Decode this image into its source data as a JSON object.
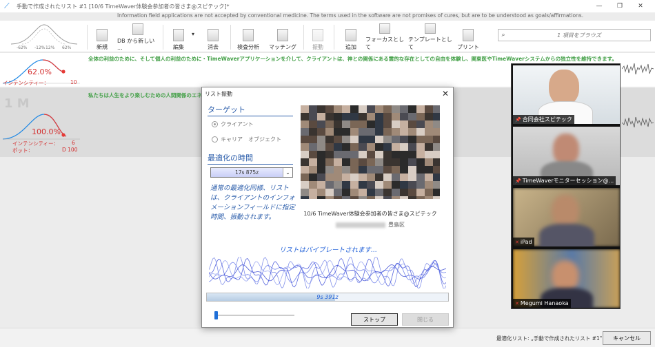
{
  "window": {
    "title": "手動で作成されたリスト #1 [10/6 TimeWaver体験会参加者の皆さま@スピテック]*",
    "controls": [
      "—",
      "❐",
      "✕"
    ]
  },
  "info_line": "Information field applications are not accepted by conventional medicine. The terms used in the software are not promises of cures, but are to be understood as goals/affirmations.",
  "toolbar": {
    "curve_labels": [
      "-62%",
      "-12%",
      "12%",
      "62%"
    ],
    "buttons": [
      {
        "label": "新規",
        "enabled": true
      },
      {
        "label": "DB から新しい ...",
        "enabled": true
      },
      {
        "label": "編集",
        "enabled": true
      },
      {
        "label": "消去",
        "enabled": true
      },
      {
        "label": "検査分析",
        "enabled": true
      },
      {
        "label": "マッチング",
        "enabled": true
      },
      {
        "label": "振動",
        "enabled": false
      },
      {
        "label": "追加",
        "enabled": true
      },
      {
        "label": "フォーカスとして",
        "enabled": true
      },
      {
        "label": "テンプレートとして",
        "enabled": true
      },
      {
        "label": "プリント",
        "enabled": true
      }
    ],
    "search_placeholder": "1 項目をブラウズ"
  },
  "row1": {
    "percent": "62.0%",
    "intensity_label": "インテンシティー：",
    "intensity_value": "10",
    "text": "全体の利益のために、そして個人の利益のために・TimeWaverアプリケーションを介して、クライアントは、神との関係にある霊的な存在としての自由を体験し、関東医やTimeWaverシステムからの独立性を維持できます。"
  },
  "row2": {
    "big_label": "1 M",
    "percent": "100.0%",
    "intensity_label": "インテンシティー：",
    "intensity_value": "6",
    "pot_label": "ポット：",
    "pot_value": "D 100",
    "text": "私たちは人生をより楽しむための人間関係のエネル"
  },
  "bottom": {
    "status": "最適化リスト: „手動で作成されたリスト #1\"",
    "cancel_label": "キャンセル"
  },
  "dialog": {
    "title": "リスト振動",
    "target_title": "ターゲット",
    "radio_client": "クライアント",
    "radio_carrier": "キャリア",
    "radio_object": "オブジェクト",
    "time_title": "最適化の時間",
    "time_value": "17s 875z",
    "description": "通常の最適化同様、リストは、クライアントのインフォメーションフィールドに指定時間、振動されます。",
    "client_name": "10/6 TimeWaver体験会参加者の皆さま@スピテック",
    "client_addr": "豊島区",
    "vibrating_text": "リストはバイブレートされます...",
    "progress_text": "9s 391z",
    "progress_fraction": 0.53,
    "stop_label": "ストップ",
    "close_label": "閉じる"
  },
  "video": {
    "participants": [
      {
        "name": "合同会社スピテック",
        "active": true,
        "color": "#e9eef2"
      },
      {
        "name": "TimeWaverモニターセッション@...",
        "active": false,
        "color": "#c8c8c8"
      },
      {
        "name": "iPad",
        "active": false,
        "color": "#b9a27a"
      },
      {
        "name": "Megumi Hanaoka",
        "active": false,
        "color": "#c9a060"
      }
    ]
  }
}
